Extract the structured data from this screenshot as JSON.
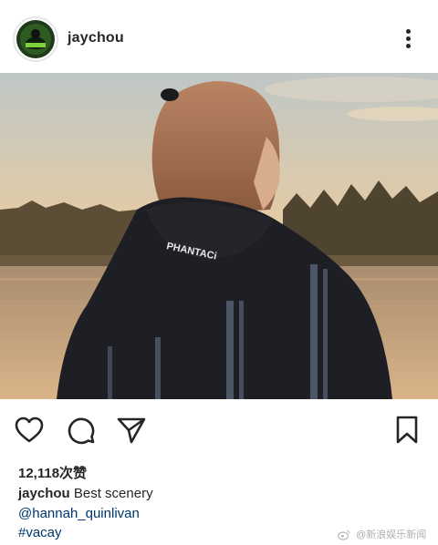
{
  "post": {
    "username": "jaychou",
    "likes": "12,118次赞",
    "caption_user": "jaychou",
    "caption_text": "Best scenery",
    "mention": "@hannah_quinlivan",
    "hashtag": "#vacay",
    "hoodie_text": "PHANTACi"
  },
  "watermark": {
    "text": "@新浪娱乐新闻",
    "icon": "weibo-logo-icon"
  },
  "icons": {
    "more": "more-vertical-icon",
    "like": "heart-icon",
    "comment": "comment-bubble-icon",
    "share": "send-paper-plane-icon",
    "save": "bookmark-icon"
  },
  "colors": {
    "text": "#262626",
    "link": "#00376b",
    "background": "#ffffff"
  }
}
